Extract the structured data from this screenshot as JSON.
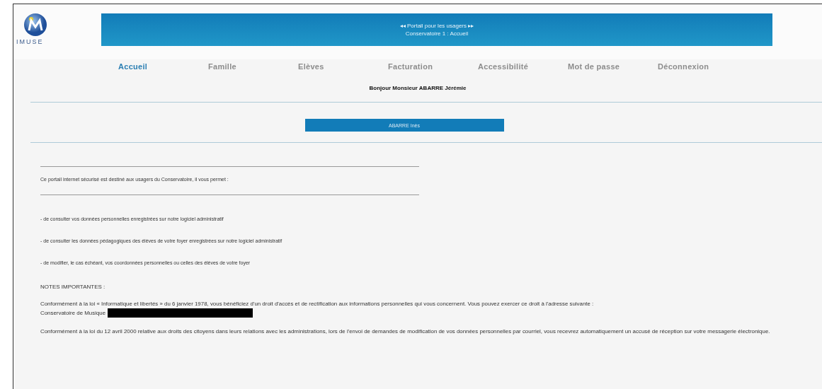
{
  "logo": {
    "text": "IMUSE"
  },
  "banner": {
    "line_1": "◂◂ Portail pour les usagers ▸▸",
    "line_2": "Conservatoire 1 : Accueil"
  },
  "nav": [
    {
      "label": "Accueil",
      "selected": true
    },
    {
      "label": "Famille",
      "selected": false
    },
    {
      "label": "Elèves",
      "selected": false
    },
    {
      "label": "Facturation",
      "selected": false
    },
    {
      "label": "Accessibilité",
      "selected": false
    },
    {
      "label": "Mot de passe",
      "selected": false
    },
    {
      "label": "Déconnexion",
      "selected": false
    }
  ],
  "greeting": "Bonjour Monsieur ABARRE Jérémie",
  "student_buttons": [
    "ABARRE Inès"
  ],
  "intro": "Ce portail internet sécurisé est destiné aux usagers du Conservatoire, il vous permet :",
  "features": [
    "- de consulter vos données personnelles enregistrées sur notre logiciel administratif",
    "- de consulter les données pédagogiques des élèves de votre foyer enregistrées sur notre logiciel administratif",
    "- de modifier, le cas échéant, vos coordonnées personnelles ou celles des élèves de votre foyer"
  ],
  "notes_title": "NOTES IMPORTANTES :",
  "notes": [
    {
      "text": "Conformément à la loi « Informatique et libertés » du 6 janvier 1978, vous bénéficiez d'un droit d'accès et de rectification aux informations personnelles qui vous concernent. Vous pouvez exercer ce droit à l'adresse suivante :",
      "address": "Conservatoire de Musique"
    },
    {
      "text": "Conformément à la loi du 12 avril 2000 relative aux droits des citoyens dans leurs relations avec les administrations, lors de l'envoi de demandes de modification de vos données personnelles par courriel, vous recevrez automatiquement un accusé de réception sur votre messagerie électronique."
    }
  ]
}
